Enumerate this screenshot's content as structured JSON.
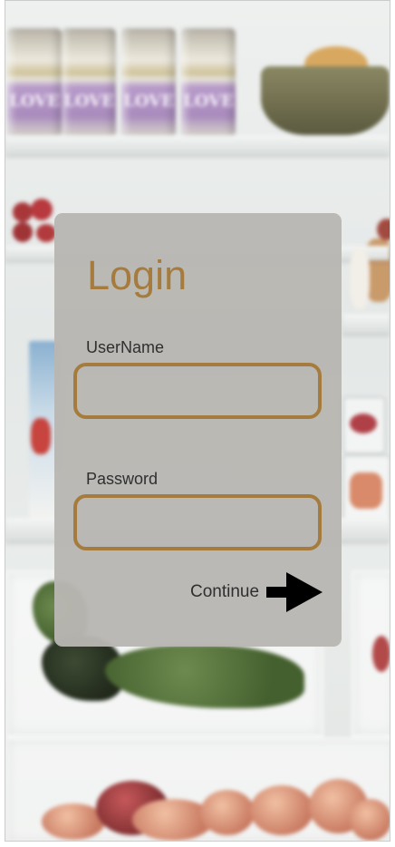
{
  "login": {
    "title": "Login",
    "username_label": "UserName",
    "username_value": "",
    "password_label": "Password",
    "password_value": "",
    "continue_label": "Continue",
    "continue_icon": "arrow-right-icon"
  },
  "background": {
    "can_text": "LOVE"
  },
  "colors": {
    "accent": "#a67c3e",
    "card": "#b8b6b2",
    "text": "#2f2f2f"
  }
}
